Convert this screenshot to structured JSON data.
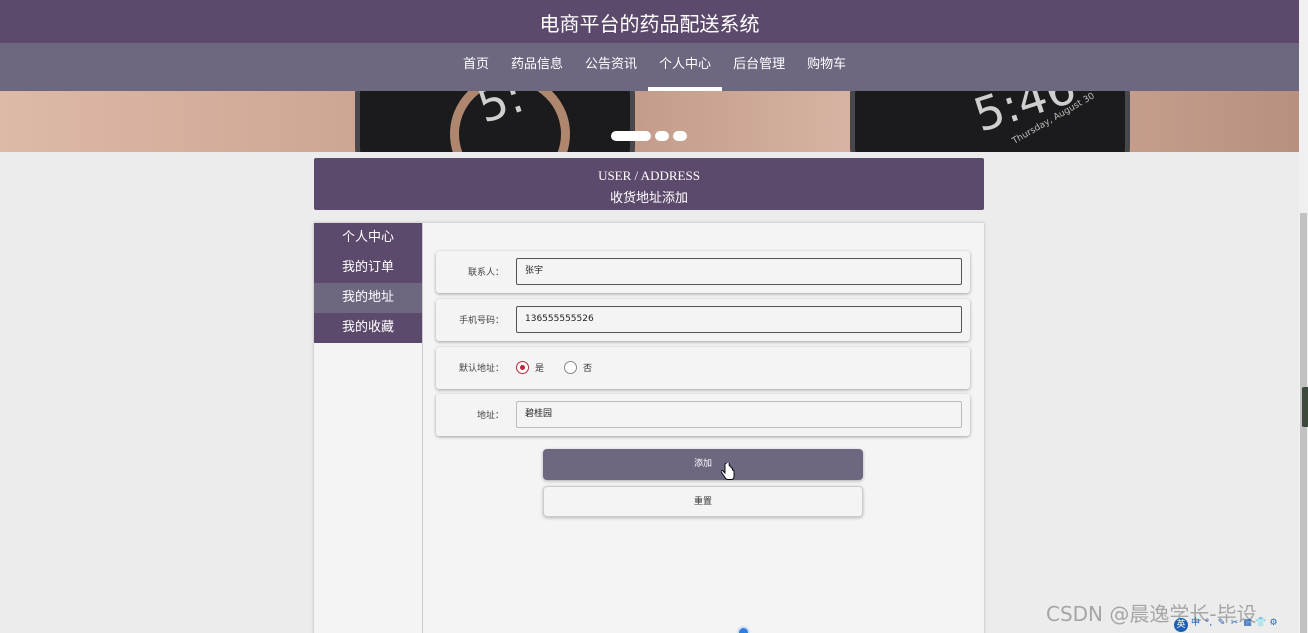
{
  "header": {
    "site_title": "电商平台的药品配送系统"
  },
  "nav": {
    "items": [
      {
        "label": "首页"
      },
      {
        "label": "药品信息"
      },
      {
        "label": "公告资讯"
      },
      {
        "label": "个人中心",
        "active": true
      },
      {
        "label": "后台管理"
      },
      {
        "label": "购物车"
      }
    ]
  },
  "banner": {
    "clock_left": "5:",
    "clock_right": "5:46",
    "date_text": "Thursday, August 30",
    "carousel_dots": 3,
    "active_dot": 0
  },
  "section": {
    "title_en": "USER / ADDRESS",
    "title_zh": "收货地址添加"
  },
  "sidebar": {
    "items": [
      {
        "label": "个人中心"
      },
      {
        "label": "我的订单"
      },
      {
        "label": "我的地址",
        "active": true
      },
      {
        "label": "我的收藏"
      }
    ]
  },
  "form": {
    "contact": {
      "label": "联系人：",
      "value": "张宇"
    },
    "phone": {
      "label": "手机号码：",
      "value": "136555555526"
    },
    "default": {
      "label": "默认地址：",
      "yes_label": "是",
      "no_label": "否",
      "selected": "是"
    },
    "address": {
      "label": "地址：",
      "value": "碧桂园"
    },
    "add_button": "添加",
    "reset_button": "重置"
  },
  "watermark": "CSDN @晨逸学长-毕设",
  "tray_icons": [
    "英",
    "中",
    "°,",
    "✎",
    "✂",
    "▦",
    "👕",
    "⚙"
  ],
  "colors": {
    "primary": "#5c4a6c",
    "secondary": "#6e6780",
    "radio_checked": "#b22a3a",
    "background": "#ececec"
  }
}
